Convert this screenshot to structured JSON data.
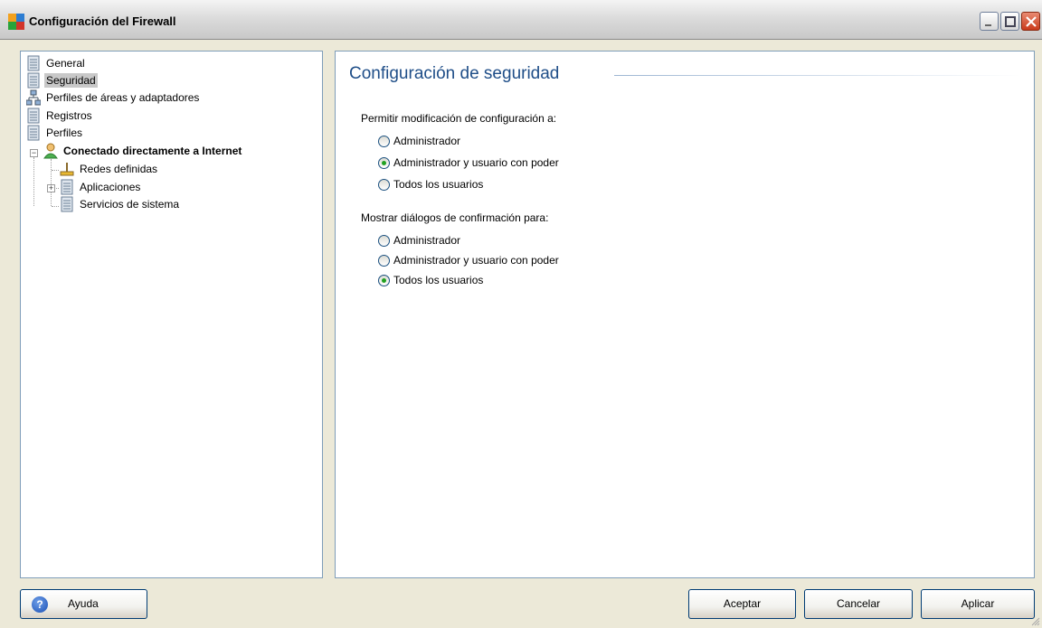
{
  "window": {
    "title": "Configuración del Firewall"
  },
  "tree": {
    "items": [
      {
        "label": "General",
        "icon": "document-list-icon"
      },
      {
        "label": "Seguridad",
        "icon": "document-list-icon",
        "selected": true
      },
      {
        "label": "Perfiles de áreas y adaptadores",
        "icon": "network-icon"
      },
      {
        "label": "Registros",
        "icon": "document-list-icon"
      },
      {
        "label": "Perfiles",
        "icon": "document-list-icon"
      },
      {
        "label": "Conectado directamente a Internet",
        "icon": "user-profile-icon",
        "bold": true
      },
      {
        "label": "Redes definidas",
        "icon": "network-node-icon"
      },
      {
        "label": "Aplicaciones",
        "icon": "document-list-icon"
      },
      {
        "label": "Servicios de sistema",
        "icon": "document-list-icon"
      }
    ]
  },
  "content": {
    "title": "Configuración de seguridad",
    "modify_group": {
      "label": "Permitir modificación de configuración a:",
      "options": [
        "Administrador",
        "Administrador y usuario con poder",
        "Todos los usuarios"
      ],
      "selected": "Administrador y usuario con poder"
    },
    "confirm_group": {
      "label": "Mostrar diálogos de confirmación para:",
      "options": [
        "Administrador",
        "Administrador y usuario con poder",
        "Todos los usuarios"
      ],
      "selected": "Todos los usuarios"
    }
  },
  "buttons": {
    "help": "Ayuda",
    "accept": "Aceptar",
    "cancel": "Cancelar",
    "apply": "Aplicar"
  },
  "colors": {
    "title_text": "#1f4e88",
    "selection_bg": "#c8c8c8",
    "radio_dot": "#21a121",
    "panel_border": "#7f9db9",
    "dialog_bg": "#ece9d8"
  }
}
